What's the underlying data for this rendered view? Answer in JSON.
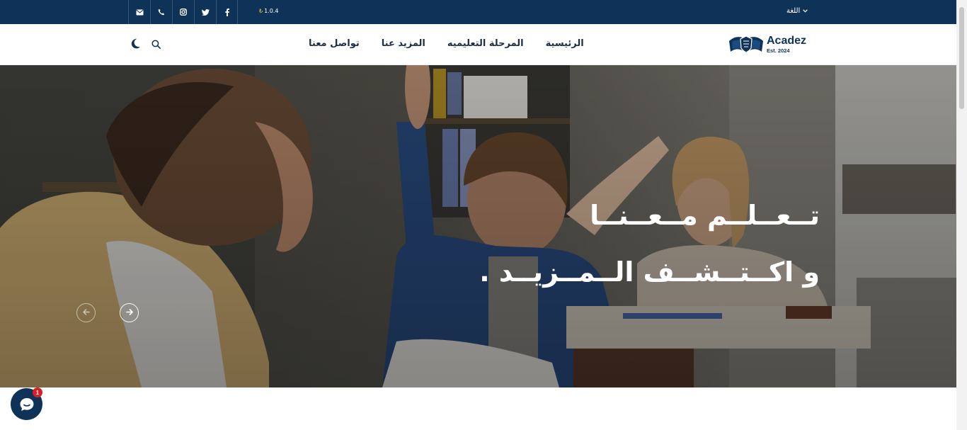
{
  "topbar": {
    "version": "1.0.4",
    "version_symbol": "₺",
    "language_label": "اللغة",
    "social": [
      "facebook-icon",
      "twitter-icon",
      "instagram-icon",
      "phone-icon",
      "email-icon"
    ]
  },
  "header": {
    "logo": {
      "brand": "Acadez",
      "established": "Est. 2024"
    },
    "nav": [
      "الرئيسية",
      "المرحلة التعليميه",
      "المزيد عنا",
      "تواصل معنا"
    ],
    "tools": [
      "moon-icon",
      "search-icon"
    ]
  },
  "hero": {
    "line1": "تــعــلــم مــعــنــا",
    "line2": "و اكــتــشــف الــمــزيــد ."
  },
  "chat": {
    "badge": "1"
  },
  "colors": {
    "primary": "#0f3358",
    "badge": "#d81f26",
    "accent": "#e9b44c"
  }
}
